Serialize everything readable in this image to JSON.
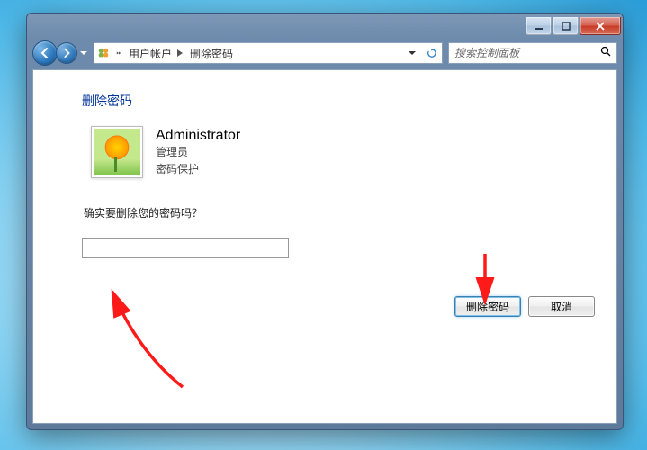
{
  "breadcrumb": {
    "seg1": "用户帐户",
    "seg2": "删除密码"
  },
  "search": {
    "placeholder": "搜索控制面板"
  },
  "page": {
    "title": "删除密码",
    "user_name": "Administrator",
    "role_line": "管理员",
    "protect_line": "密码保护",
    "prompt": "确实要删除您的密码吗？",
    "password_value": ""
  },
  "buttons": {
    "confirm": "删除密码",
    "cancel": "取消"
  }
}
